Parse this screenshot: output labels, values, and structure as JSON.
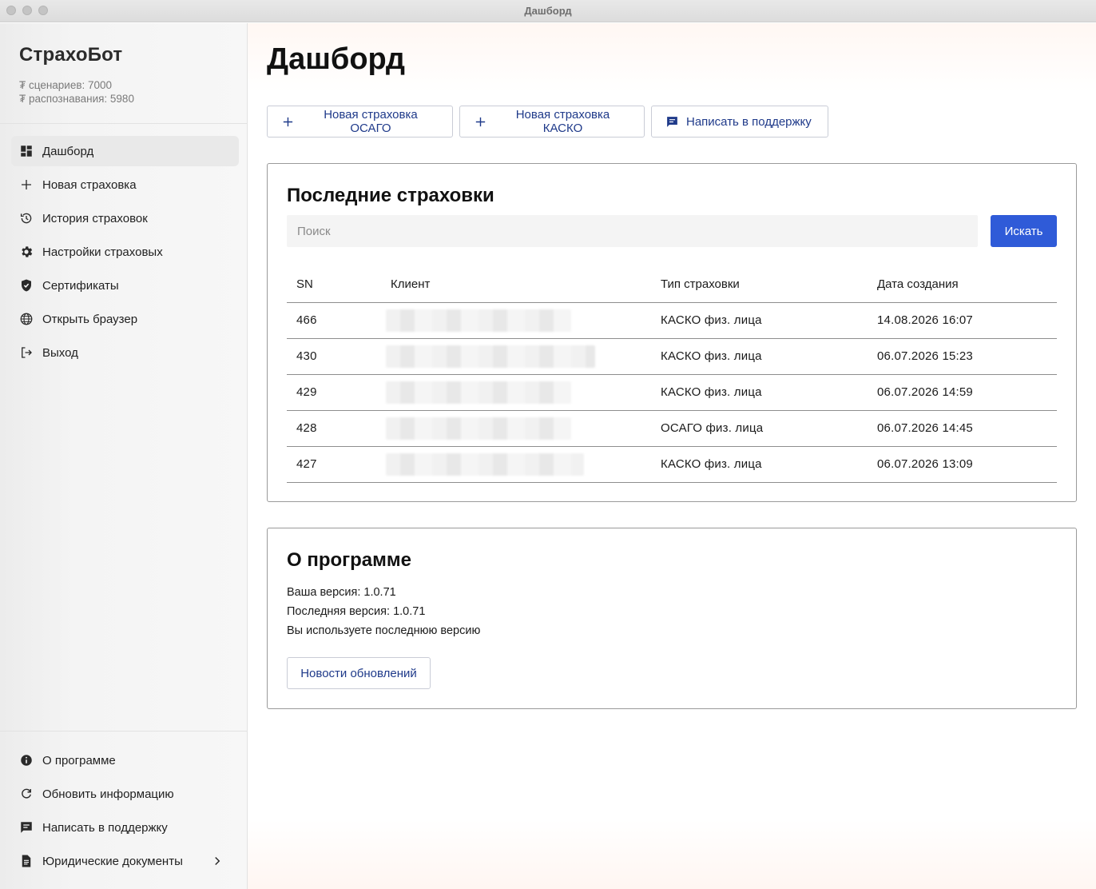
{
  "window": {
    "title": "Дашборд"
  },
  "sidebar": {
    "brand": "СтрахоБот",
    "stats": [
      "₮ сценариев: 7000",
      "₮ распознавания: 5980"
    ],
    "nav": [
      {
        "label": "Дашборд",
        "icon": "dashboard-icon",
        "active": true
      },
      {
        "label": "Новая страховка",
        "icon": "plus-icon"
      },
      {
        "label": "История страховок",
        "icon": "history-icon"
      },
      {
        "label": "Настройки страховых",
        "icon": "gear-icon"
      },
      {
        "label": "Сертификаты",
        "icon": "shield-check-icon"
      },
      {
        "label": "Открыть браузер",
        "icon": "globe-icon"
      },
      {
        "label": "Выход",
        "icon": "logout-icon"
      }
    ],
    "bottom": [
      {
        "label": "О программе",
        "icon": "info-icon"
      },
      {
        "label": "Обновить информацию",
        "icon": "refresh-icon"
      },
      {
        "label": "Написать в поддержку",
        "icon": "chat-icon"
      },
      {
        "label": "Юридические документы",
        "icon": "document-icon",
        "chevron": "chevron-right-icon"
      }
    ]
  },
  "main": {
    "title": "Дашборд",
    "actions": [
      {
        "label": "Новая страховка ОСАГО",
        "icon": "plus-icon"
      },
      {
        "label": "Новая страховка КАСКО",
        "icon": "plus-icon"
      },
      {
        "label": "Написать в поддержку",
        "icon": "chat-icon"
      }
    ],
    "recent": {
      "title": "Последние страховки",
      "search_placeholder": "Поиск",
      "search_button": "Искать",
      "columns": [
        "SN",
        "Клиент",
        "Тип страховки",
        "Дата создания"
      ],
      "rows": [
        {
          "sn": "466",
          "type": "КАСКО физ. лица",
          "date": "14.08.2026 16:07"
        },
        {
          "sn": "430",
          "type": "КАСКО физ. лица",
          "date": "06.07.2026 15:23"
        },
        {
          "sn": "429",
          "type": "КАСКО физ. лица",
          "date": "06.07.2026 14:59"
        },
        {
          "sn": "428",
          "type": "ОСАГО физ. лица",
          "date": "06.07.2026 14:45"
        },
        {
          "sn": "427",
          "type": "КАСКО физ. лица",
          "date": "06.07.2026 13:09"
        }
      ]
    },
    "about": {
      "title": "О программе",
      "your_version": "Ваша версия: 1.0.71",
      "latest_version": "Последняя версия: 1.0.71",
      "status": "Вы используете последнюю версию",
      "news_button": "Новости обновлений"
    }
  },
  "colors": {
    "primary": "#2f5bd8",
    "outline_text": "#1f3a8a"
  }
}
